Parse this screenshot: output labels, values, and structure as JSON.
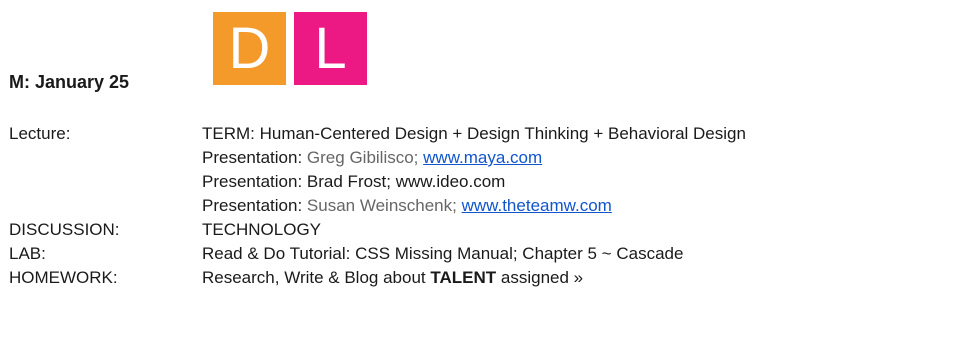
{
  "heading": "M: January 25",
  "logo": {
    "d_letter": "D",
    "l_letter": "L",
    "d_color": "#f39a2b",
    "l_color": "#ec1884"
  },
  "schedule": {
    "lecture": {
      "label": "Lecture:",
      "term": "TERM: Human-Centered Design + Design Thinking + Behavioral Design"
    },
    "presentations": [
      {
        "prefix": "Presentation:",
        "name": "Greg Gibilisco;",
        "link": "www.maya.com"
      },
      {
        "prefix": "Presentation:",
        "name": "Brad Frost; www.ideo.com"
      },
      {
        "prefix": "Presentation:",
        "name": "Susan Weinschenk;",
        "link": "www.theteamw.com"
      }
    ],
    "discussion": {
      "label": "DISCUSSION:",
      "value": "TECHNOLOGY"
    },
    "lab": {
      "label": "LAB:",
      "value": "Read & Do Tutorial: CSS Missing Manual; Chapter 5 ~ Cascade"
    },
    "homework": {
      "label": "HOMEWORK:",
      "value_before": "Research, Write & Blog about",
      "value_bold": "TALENT",
      "value_after": "assigned »"
    }
  },
  "colors": {
    "link": "#1155cc",
    "muted_text": "#666666"
  }
}
